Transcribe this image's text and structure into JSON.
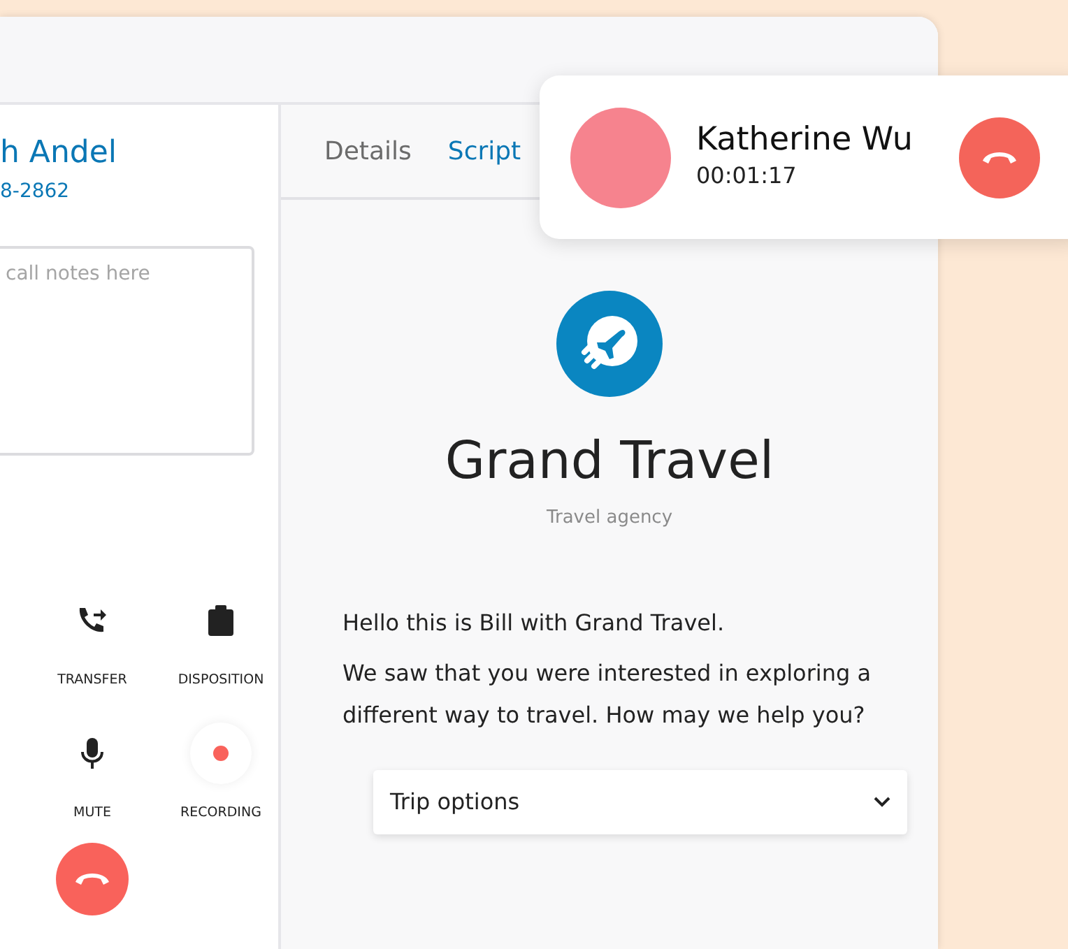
{
  "contact": {
    "name": "h Andel",
    "phone": "8-2862"
  },
  "notes": {
    "placeholder": "call notes here"
  },
  "actions": [
    {
      "kind": "transfer",
      "label": "TRANSFER",
      "on": false
    },
    {
      "kind": "disposition",
      "label": "DISPOSITION",
      "on": false
    },
    {
      "kind": "mute",
      "label": "MUTE",
      "on": false
    },
    {
      "kind": "record",
      "label": "RECORDING",
      "on": true
    }
  ],
  "tabs": [
    {
      "label": "Details",
      "selected": false
    },
    {
      "label": "Script",
      "selected": true
    }
  ],
  "script": {
    "title": "Grand Travel",
    "subtitle": "Travel agency",
    "paragraphs": [
      "Hello this is Bill with Grand Travel.",
      "We saw that you were interested in exploring a different way to travel. How may we help you?"
    ],
    "dropdown": {
      "label": "Trip options",
      "expanded": false
    }
  },
  "call": {
    "name": "Katherine Wu",
    "timer": "00:01:17"
  }
}
